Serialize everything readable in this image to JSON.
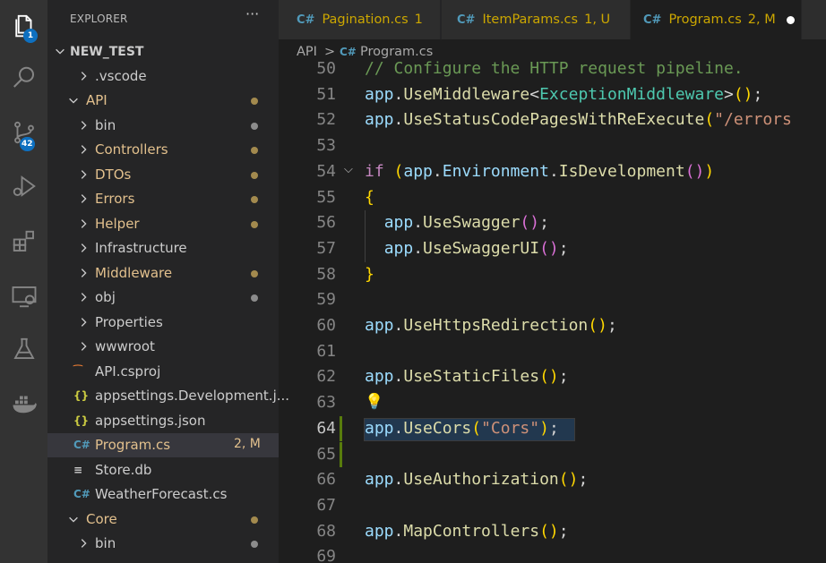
{
  "activity_bar": {
    "explorer_badge": "1",
    "source_control_badge": "42",
    "icons": [
      "files-icon",
      "search-icon",
      "source-control-icon",
      "run-debug-icon",
      "extensions-icon",
      "remote-explorer-icon",
      "testing-icon",
      "docker-icon"
    ]
  },
  "sidebar": {
    "header": "EXPLORER",
    "more": "···",
    "root": "NEW_TEST",
    "items": [
      {
        "label": ".vscode",
        "kind": "folder",
        "expanded": false,
        "color": "#cccccc"
      },
      {
        "label": "API",
        "kind": "folder",
        "expanded": true,
        "color": "#e2c08d",
        "dot": "#a38a4e"
      },
      {
        "label": "bin",
        "kind": "folder",
        "expanded": false,
        "color": "#cccccc",
        "dot": "#8c8c8c"
      },
      {
        "label": "Controllers",
        "kind": "folder",
        "expanded": false,
        "color": "#e2c08d",
        "dot": "#a38a4e"
      },
      {
        "label": "DTOs",
        "kind": "folder",
        "expanded": false,
        "color": "#e2c08d",
        "dot": "#a38a4e"
      },
      {
        "label": "Errors",
        "kind": "folder",
        "expanded": false,
        "color": "#e2c08d",
        "dot": "#a38a4e"
      },
      {
        "label": "Helper",
        "kind": "folder",
        "expanded": false,
        "color": "#e2c08d",
        "dot": "#a38a4e"
      },
      {
        "label": "Infrastructure",
        "kind": "folder",
        "expanded": false,
        "color": "#cccccc"
      },
      {
        "label": "Middleware",
        "kind": "folder",
        "expanded": false,
        "color": "#e2c08d",
        "dot": "#a38a4e"
      },
      {
        "label": "obj",
        "kind": "folder",
        "expanded": false,
        "color": "#cccccc",
        "dot": "#8c8c8c"
      },
      {
        "label": "Properties",
        "kind": "folder",
        "expanded": false,
        "color": "#cccccc"
      },
      {
        "label": "wwwroot",
        "kind": "folder",
        "expanded": false,
        "color": "#cccccc"
      },
      {
        "label": "API.csproj",
        "kind": "file",
        "icon": "rss-icon",
        "glyph": "⁀",
        "color": "#cccccc"
      },
      {
        "label": "appsettings.Development.j...",
        "kind": "file",
        "icon": "json-icon",
        "glyph": "{}",
        "color": "#cccccc"
      },
      {
        "label": "appsettings.json",
        "kind": "file",
        "icon": "json-icon",
        "glyph": "{}",
        "color": "#cccccc"
      },
      {
        "label": "Program.cs",
        "kind": "file",
        "icon": "csharp-icon",
        "glyph": "C#",
        "color": "#e2c08d",
        "selected": true,
        "status": "2, M"
      },
      {
        "label": "Store.db",
        "kind": "file",
        "icon": "database-icon",
        "glyph": "≡",
        "color": "#cccccc"
      },
      {
        "label": "WeatherForecast.cs",
        "kind": "file",
        "icon": "csharp-icon",
        "glyph": "C#",
        "color": "#cccccc"
      },
      {
        "label": "Core",
        "kind": "folder",
        "expanded": true,
        "color": "#e2c08d",
        "dot": "#a38a4e",
        "level": 1
      },
      {
        "label": "bin",
        "kind": "folder",
        "expanded": false,
        "color": "#cccccc",
        "dot": "#8c8c8c"
      }
    ]
  },
  "tabs": [
    {
      "label": "Pagination.cs",
      "badge": "1",
      "color": "#cca700"
    },
    {
      "label": "ItemParams.cs",
      "badge": "1, U",
      "color": "#cca700"
    },
    {
      "label": "Program.cs",
      "badge": "2, M",
      "color": "#cca700",
      "active": true,
      "dirty": true
    }
  ],
  "breadcrumb": {
    "folder": "API",
    "separator": ">",
    "file": "Program.cs"
  },
  "editor": {
    "current_line": "64",
    "lines": [
      {
        "n": "50",
        "tokens": [
          {
            "t": "// Configure the HTTP request pipeline.",
            "c": "c"
          }
        ]
      },
      {
        "n": "51",
        "tokens": [
          {
            "t": "app",
            "c": "v"
          },
          {
            "t": ".",
            "c": "p"
          },
          {
            "t": "UseMiddleware",
            "c": "f"
          },
          {
            "t": "<",
            "c": "p"
          },
          {
            "t": "ExceptionMiddleware",
            "c": "t"
          },
          {
            "t": ">",
            "c": "p"
          },
          {
            "t": "()",
            "c": "b1"
          },
          {
            "t": ";",
            "c": "p"
          }
        ]
      },
      {
        "n": "52",
        "tokens": [
          {
            "t": "app",
            "c": "v"
          },
          {
            "t": ".",
            "c": "p"
          },
          {
            "t": "UseStatusCodePagesWithReExecute",
            "c": "f"
          },
          {
            "t": "(",
            "c": "b1"
          },
          {
            "t": "\"/errors",
            "c": "s"
          }
        ]
      },
      {
        "n": "53",
        "tokens": []
      },
      {
        "n": "54",
        "tokens": [
          {
            "t": "if",
            "c": "k"
          },
          {
            "t": " ",
            "c": "p"
          },
          {
            "t": "(",
            "c": "b1"
          },
          {
            "t": "app",
            "c": "v"
          },
          {
            "t": ".",
            "c": "p"
          },
          {
            "t": "Environment",
            "c": "v"
          },
          {
            "t": ".",
            "c": "p"
          },
          {
            "t": "IsDevelopment",
            "c": "f"
          },
          {
            "t": "()",
            "c": "b2"
          },
          {
            "t": ")",
            "c": "b1"
          }
        ],
        "fold": "⌵"
      },
      {
        "n": "55",
        "tokens": [
          {
            "t": "{",
            "c": "b1"
          }
        ]
      },
      {
        "n": "56",
        "tokens": [
          {
            "t": "  ",
            "c": "p"
          },
          {
            "t": "app",
            "c": "v"
          },
          {
            "t": ".",
            "c": "p"
          },
          {
            "t": "UseSwagger",
            "c": "f"
          },
          {
            "t": "()",
            "c": "b2"
          },
          {
            "t": ";",
            "c": "p"
          }
        ]
      },
      {
        "n": "57",
        "tokens": [
          {
            "t": "  ",
            "c": "p"
          },
          {
            "t": "app",
            "c": "v"
          },
          {
            "t": ".",
            "c": "p"
          },
          {
            "t": "UseSwaggerUI",
            "c": "f"
          },
          {
            "t": "()",
            "c": "b2"
          },
          {
            "t": ";",
            "c": "p"
          }
        ]
      },
      {
        "n": "58",
        "tokens": [
          {
            "t": "}",
            "c": "b1"
          }
        ]
      },
      {
        "n": "59",
        "tokens": []
      },
      {
        "n": "60",
        "tokens": [
          {
            "t": "app",
            "c": "v"
          },
          {
            "t": ".",
            "c": "p"
          },
          {
            "t": "UseHttpsRedirection",
            "c": "f"
          },
          {
            "t": "()",
            "c": "b1"
          },
          {
            "t": ";",
            "c": "p"
          }
        ]
      },
      {
        "n": "61",
        "tokens": []
      },
      {
        "n": "62",
        "tokens": [
          {
            "t": "app",
            "c": "v"
          },
          {
            "t": ".",
            "c": "p"
          },
          {
            "t": "UseStaticFiles",
            "c": "f"
          },
          {
            "t": "()",
            "c": "b1"
          },
          {
            "t": ";",
            "c": "p"
          }
        ]
      },
      {
        "n": "63",
        "tokens": [],
        "lightbulb": true
      },
      {
        "n": "64",
        "tokens": [
          {
            "t": "app",
            "c": "v"
          },
          {
            "t": ".",
            "c": "p"
          },
          {
            "t": "UseCors",
            "c": "f"
          },
          {
            "t": "(",
            "c": "b1"
          },
          {
            "t": "\"Cors\"",
            "c": "s"
          },
          {
            "t": ")",
            "c": "b1"
          },
          {
            "t": ";",
            "c": "p"
          }
        ],
        "modified": true
      },
      {
        "n": "65",
        "tokens": [],
        "modified": true
      },
      {
        "n": "66",
        "tokens": [
          {
            "t": "app",
            "c": "v"
          },
          {
            "t": ".",
            "c": "p"
          },
          {
            "t": "UseAuthorization",
            "c": "f"
          },
          {
            "t": "()",
            "c": "b1"
          },
          {
            "t": ";",
            "c": "p"
          }
        ]
      },
      {
        "n": "67",
        "tokens": []
      },
      {
        "n": "68",
        "tokens": [
          {
            "t": "app",
            "c": "v"
          },
          {
            "t": ".",
            "c": "p"
          },
          {
            "t": "MapControllers",
            "c": "f"
          },
          {
            "t": "()",
            "c": "b1"
          },
          {
            "t": ";",
            "c": "p"
          }
        ]
      },
      {
        "n": "69",
        "tokens": []
      }
    ]
  }
}
